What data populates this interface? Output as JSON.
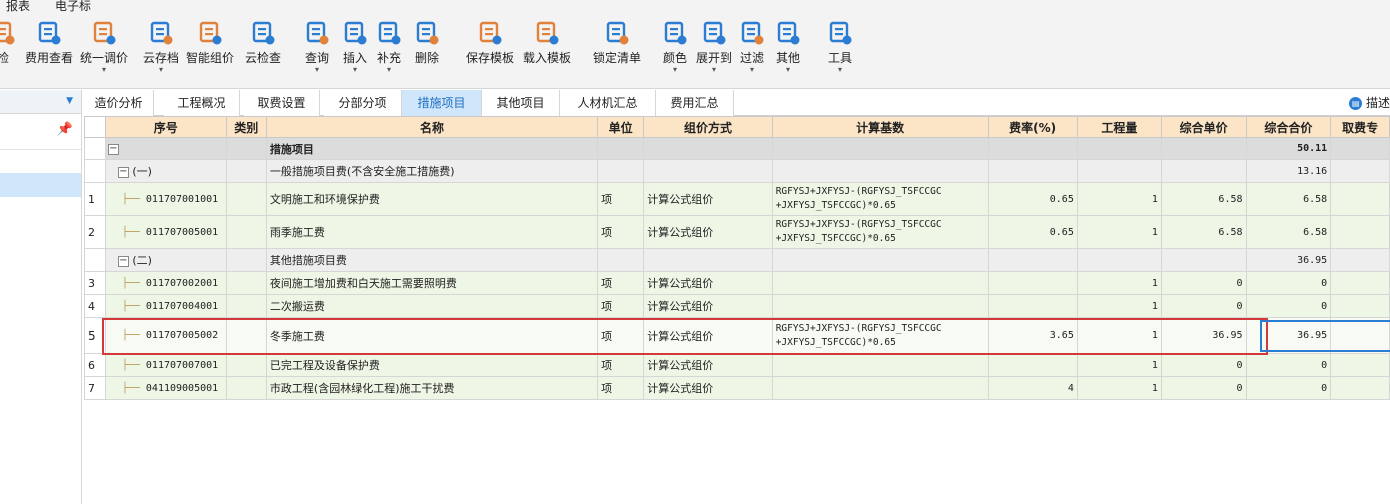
{
  "menu": [
    "报表",
    "电子标"
  ],
  "toolbar": [
    {
      "label": "检",
      "icon": "check-icon",
      "dropdown": false
    },
    {
      "label": "费用查看",
      "icon": "view-fee-icon",
      "dropdown": false
    },
    {
      "label": "统一调价",
      "icon": "adjust-price-icon",
      "dropdown": true
    },
    {
      "label": "云存档",
      "icon": "cloud-archive-icon",
      "dropdown": true
    },
    {
      "label": "智能组价",
      "icon": "smart-price-icon",
      "dropdown": false
    },
    {
      "label": "云检查",
      "icon": "cloud-check-icon",
      "dropdown": false
    },
    {
      "label": "查询",
      "icon": "query-icon",
      "dropdown": true
    },
    {
      "label": "插入",
      "icon": "insert-icon",
      "dropdown": true
    },
    {
      "label": "补充",
      "icon": "supplement-icon",
      "dropdown": true
    },
    {
      "label": "删除",
      "icon": "delete-icon",
      "dropdown": false
    },
    {
      "label": "保存模板",
      "icon": "save-template-icon",
      "dropdown": false
    },
    {
      "label": "载入模板",
      "icon": "load-template-icon",
      "dropdown": false
    },
    {
      "label": "锁定清单",
      "icon": "lock-icon",
      "dropdown": false
    },
    {
      "label": "颜色",
      "icon": "color-icon",
      "dropdown": true
    },
    {
      "label": "展开到",
      "icon": "expand-icon",
      "dropdown": true
    },
    {
      "label": "过滤",
      "icon": "filter-icon",
      "dropdown": true
    },
    {
      "label": "其他",
      "icon": "other-icon",
      "dropdown": true
    },
    {
      "label": "工具",
      "icon": "tools-icon",
      "dropdown": true
    }
  ],
  "tabs": [
    {
      "label": "造价分析",
      "active": false
    },
    {
      "label": "工程概况",
      "active": false
    },
    {
      "label": "取费设置",
      "active": false
    },
    {
      "label": "分部分项",
      "active": false
    },
    {
      "label": "措施项目",
      "active": true
    },
    {
      "label": "其他项目",
      "active": false
    },
    {
      "label": "人材机汇总",
      "active": false
    },
    {
      "label": "费用汇总",
      "active": false
    }
  ],
  "desc_button": "描述",
  "columns": [
    "序号",
    "类别",
    "名称",
    "单位",
    "组价方式",
    "计算基数",
    "费率(%)",
    "工程量",
    "综合单价",
    "综合合价",
    "取费专"
  ],
  "rows": [
    {
      "rn": "",
      "code": "",
      "expand": "−",
      "indent": 0,
      "level": 0,
      "cat": "",
      "name": "措施项目",
      "unit": "",
      "method": "",
      "basis": "",
      "rate": "",
      "qty": "",
      "price": "",
      "total": "50.11"
    },
    {
      "rn": "",
      "code": "(一)",
      "expand": "−",
      "indent": 1,
      "level": 1,
      "cat": "",
      "name": "一般措施项目费(不含安全施工措施费)",
      "unit": "",
      "method": "",
      "basis": "",
      "rate": "",
      "qty": "",
      "price": "",
      "total": "13.16"
    },
    {
      "rn": "1",
      "code": "011707001001",
      "expand": "",
      "indent": 2,
      "level": 2,
      "cat": "",
      "name": "文明施工和环境保护费",
      "unit": "项",
      "method": "计算公式组价",
      "basis": "RGFYSJ+JXFYSJ-(RGFYSJ_TSFCCGC\n+JXFYSJ_TSFCCGC)*0.65",
      "rate": "0.65",
      "qty": "1",
      "price": "6.58",
      "total": "6.58"
    },
    {
      "rn": "2",
      "code": "011707005001",
      "expand": "",
      "indent": 2,
      "level": 2,
      "cat": "",
      "name": "雨季施工费",
      "unit": "项",
      "method": "计算公式组价",
      "basis": "RGFYSJ+JXFYSJ-(RGFYSJ_TSFCCGC\n+JXFYSJ_TSFCCGC)*0.65",
      "rate": "0.65",
      "qty": "1",
      "price": "6.58",
      "total": "6.58"
    },
    {
      "rn": "",
      "code": "(二)",
      "expand": "−",
      "indent": 1,
      "level": 1,
      "cat": "",
      "name": "其他措施项目费",
      "unit": "",
      "method": "",
      "basis": "",
      "rate": "",
      "qty": "",
      "price": "",
      "total": "36.95"
    },
    {
      "rn": "3",
      "code": "011707002001",
      "expand": "",
      "indent": 2,
      "level": 2,
      "cat": "",
      "name": "夜间施工增加费和白天施工需要照明费",
      "unit": "项",
      "method": "计算公式组价",
      "basis": "",
      "rate": "",
      "qty": "1",
      "price": "0",
      "total": "0"
    },
    {
      "rn": "4",
      "code": "011707004001",
      "expand": "",
      "indent": 2,
      "level": 2,
      "cat": "",
      "name": "二次搬运费",
      "unit": "项",
      "method": "计算公式组价",
      "basis": "",
      "rate": "",
      "qty": "1",
      "price": "0",
      "total": "0"
    },
    {
      "rn": "5",
      "code": "011707005002",
      "expand": "",
      "indent": 2,
      "level": 2,
      "cat": "",
      "name": "冬季施工费",
      "unit": "项",
      "method": "计算公式组价",
      "basis": "RGFYSJ+JXFYSJ-(RGFYSJ_TSFCCGC\n+JXFYSJ_TSFCCGC)*0.65",
      "rate": "3.65",
      "qty": "1",
      "price": "36.95",
      "total": "36.95",
      "selected": true
    },
    {
      "rn": "6",
      "code": "011707007001",
      "expand": "",
      "indent": 2,
      "level": 2,
      "cat": "",
      "name": "已完工程及设备保护费",
      "unit": "项",
      "method": "计算公式组价",
      "basis": "",
      "rate": "",
      "qty": "1",
      "price": "0",
      "total": "0"
    },
    {
      "rn": "7",
      "code": "041109005001",
      "expand": "",
      "indent": 2,
      "level": 2,
      "cat": "",
      "name": "市政工程(含园林绿化工程)施工干扰费",
      "unit": "项",
      "method": "计算公式组价",
      "basis": "",
      "rate": "4",
      "qty": "1",
      "price": "0",
      "total": "0"
    }
  ]
}
